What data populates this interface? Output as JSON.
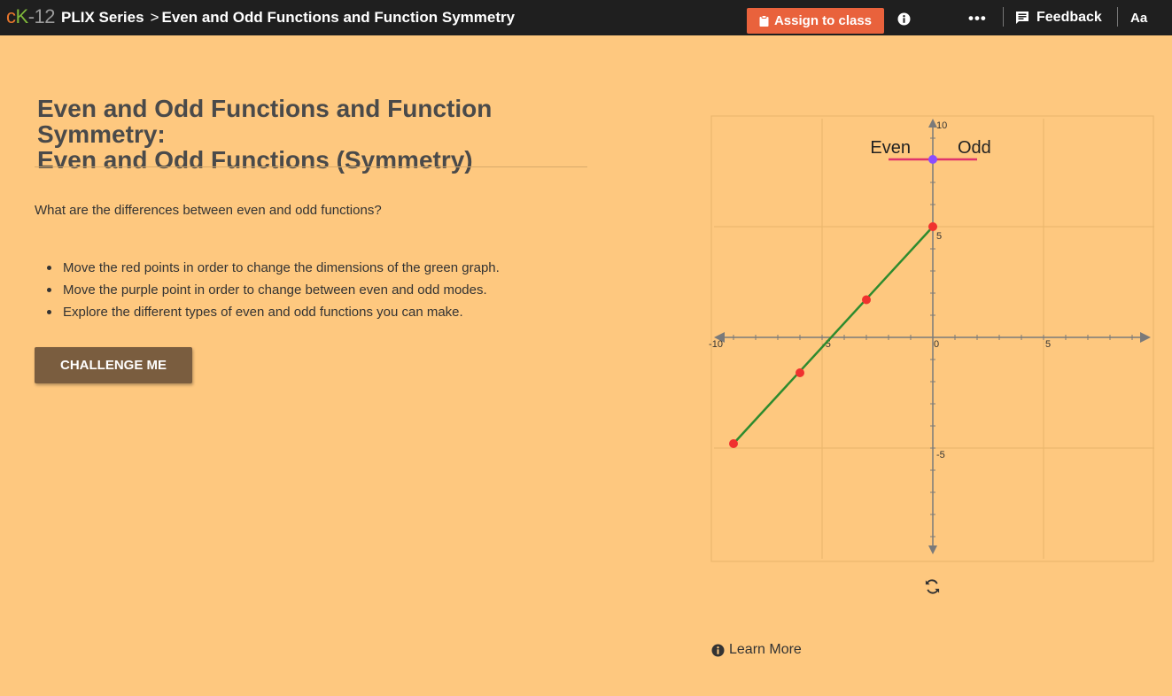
{
  "topbar": {
    "logo": {
      "c": "c",
      "k": "K",
      "d": "-12"
    },
    "series_label": "PLIX Series",
    "separator": ">",
    "page_crumb": "Even and Odd Functions and Function Symmetry",
    "assign_label": "Assign to class",
    "more_label": "•••",
    "feedback_label": "Feedback",
    "font_size_label": "Aa",
    "icons": [
      "clipboard-icon",
      "info-icon",
      "more-icon",
      "feedback-icon"
    ]
  },
  "content": {
    "title_line1": "Even and Odd Functions and Function Symmetry:",
    "title_line2": "Even and Odd Functions (Symmetry)",
    "question": "What are the differences between even and odd functions?",
    "bullets": [
      "Move the red points in order to change the dimensions of the green graph.",
      "Move the purple point in order to change between even and odd modes.",
      "Explore the different types of even and odd functions you can make."
    ],
    "challenge_label": "CHALLENGE ME"
  },
  "graph": {
    "mode_labels": {
      "even": "Even",
      "odd": "Odd"
    },
    "mode_value": 0.5,
    "x_range": [
      -10,
      10
    ],
    "y_range": [
      -10,
      10
    ],
    "x_tick_labels": [
      "-10",
      "-5",
      "0",
      "5"
    ],
    "y_tick_labels": [
      "10",
      "5",
      "-5"
    ],
    "line_points": [
      [
        -9,
        -4.8
      ],
      [
        0,
        5
      ]
    ],
    "red_points": [
      [
        -9,
        -4.8
      ],
      [
        -6,
        -1.6
      ],
      [
        -3,
        1.7
      ],
      [
        0,
        5
      ]
    ],
    "colors": {
      "line": "#2e8b2e",
      "point": "#f0312f",
      "mode_point": "#8a4dff",
      "slider": "#e0336b",
      "axis": "#7a7a7a",
      "grid": "#e8b56b"
    }
  },
  "footer": {
    "learn_more_label": "Learn More",
    "reset_icon": "refresh-icon"
  }
}
